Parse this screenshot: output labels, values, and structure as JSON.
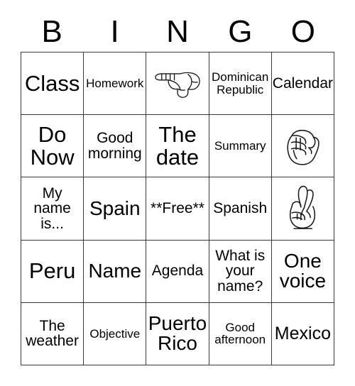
{
  "card": {
    "header_letters": [
      "B",
      "I",
      "N",
      "G",
      "O"
    ],
    "free_space_label": "**Free**",
    "rows": [
      [
        {
          "type": "text",
          "label": "Class",
          "size": "fs-xxl"
        },
        {
          "type": "text",
          "label": "Homework",
          "size": "fs-s"
        },
        {
          "type": "sign",
          "label": "hand-pointing-left-sign",
          "size": "fs-s"
        },
        {
          "type": "text",
          "label": "Dominican\nRepublic",
          "size": "fs-s"
        },
        {
          "type": "text",
          "label": "Calendar",
          "size": "fs-m"
        }
      ],
      [
        {
          "type": "text",
          "label": "Do\nNow",
          "size": "fs-xxl"
        },
        {
          "type": "text",
          "label": "Good\nmorning",
          "size": "fs-m"
        },
        {
          "type": "text",
          "label": "The\ndate",
          "size": "fs-xxl"
        },
        {
          "type": "text",
          "label": "Summary",
          "size": "fs-s"
        },
        {
          "type": "sign",
          "label": "asl-letter-s-fist-sign",
          "size": "fs-s"
        }
      ],
      [
        {
          "type": "text",
          "label": "My\nname\nis...",
          "size": "fs-m"
        },
        {
          "type": "text",
          "label": "Spain",
          "size": "fs-xl"
        },
        {
          "type": "text",
          "label": "**Free**",
          "size": "fs-m"
        },
        {
          "type": "text",
          "label": "Spanish",
          "size": "fs-m"
        },
        {
          "type": "sign",
          "label": "asl-letter-r-crossed-fingers-sign",
          "size": "fs-s"
        }
      ],
      [
        {
          "type": "text",
          "label": "Peru",
          "size": "fs-xxl"
        },
        {
          "type": "text",
          "label": "Name",
          "size": "fs-xl"
        },
        {
          "type": "text",
          "label": "Agenda",
          "size": "fs-m"
        },
        {
          "type": "text",
          "label": "What is\nyour\nname?",
          "size": "fs-m"
        },
        {
          "type": "text",
          "label": "One\nvoice",
          "size": "fs-xl"
        }
      ],
      [
        {
          "type": "text",
          "label": "The\nweather",
          "size": "fs-m"
        },
        {
          "type": "text",
          "label": "Objective",
          "size": "fs-s"
        },
        {
          "type": "text",
          "label": "Puerto\nRico",
          "size": "fs-xl"
        },
        {
          "type": "text",
          "label": "Good\nafternoon",
          "size": "fs-s"
        },
        {
          "type": "text",
          "label": "Mexico",
          "size": "fs-l"
        }
      ]
    ]
  },
  "colors": {
    "grid_line": "#3a3a3a",
    "text": "#000000",
    "background": "#ffffff",
    "sign_stroke": "#1a1a1a"
  }
}
